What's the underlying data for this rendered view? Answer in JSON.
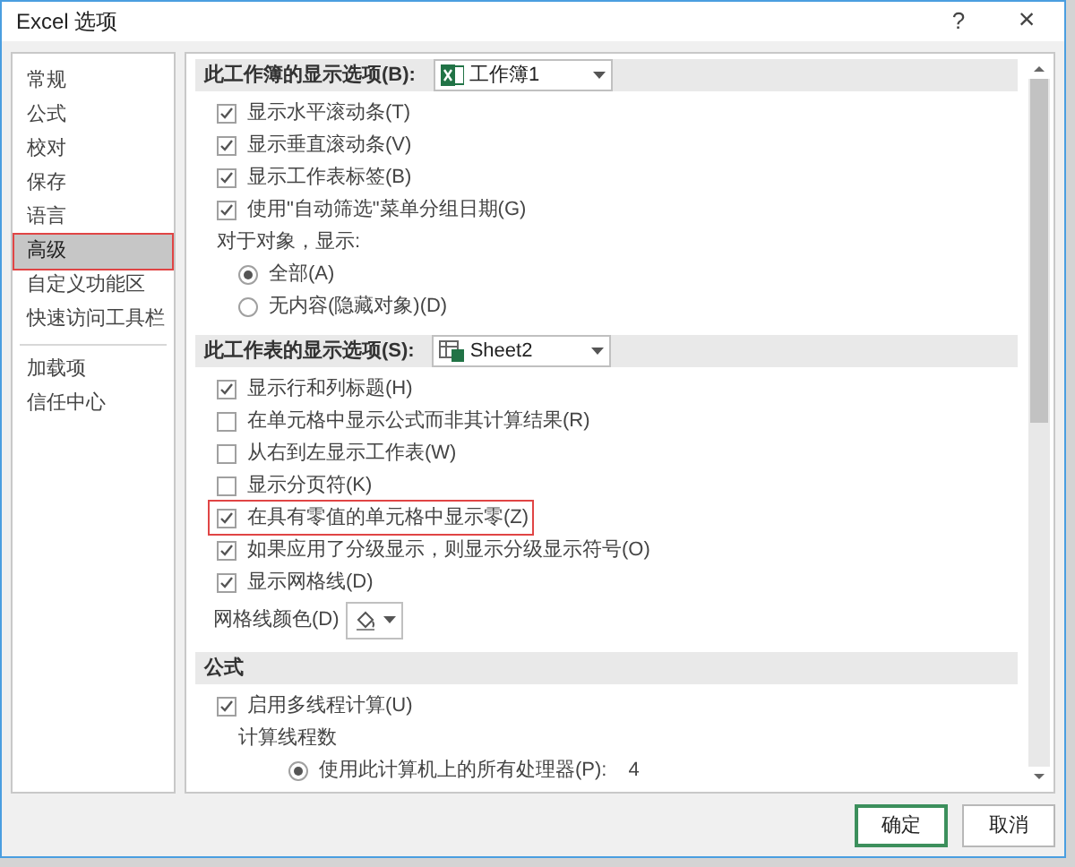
{
  "window": {
    "title": "Excel 选项",
    "help": "?",
    "close": "×"
  },
  "sidebar": {
    "items": [
      {
        "label": "常规",
        "selected": false,
        "highlighted": false
      },
      {
        "label": "公式",
        "selected": false,
        "highlighted": false
      },
      {
        "label": "校对",
        "selected": false,
        "highlighted": false
      },
      {
        "label": "保存",
        "selected": false,
        "highlighted": false
      },
      {
        "label": "语言",
        "selected": false,
        "highlighted": false
      },
      {
        "label": "高级",
        "selected": true,
        "highlighted": true
      },
      {
        "label": "自定义功能区",
        "selected": false,
        "highlighted": false
      },
      {
        "label": "快速访问工具栏",
        "selected": false,
        "highlighted": false,
        "divider_after": true
      },
      {
        "label": "加载项",
        "selected": false,
        "highlighted": false
      },
      {
        "label": "信任中心",
        "selected": false,
        "highlighted": false
      }
    ]
  },
  "sections": [
    {
      "title": "此工作簿的显示选项(B):",
      "dropdown": {
        "kind": "workbook",
        "value": "工作簿1"
      },
      "items": [
        {
          "kind": "checkbox",
          "label": "显示水平滚动条(T)",
          "checked": true,
          "highlighted": false
        },
        {
          "kind": "checkbox",
          "label": "显示垂直滚动条(V)",
          "checked": true,
          "highlighted": false
        },
        {
          "kind": "checkbox",
          "label": "显示工作表标签(B)",
          "checked": true,
          "highlighted": false
        },
        {
          "kind": "checkbox",
          "label": "使用\"自动筛选\"菜单分组日期(G)",
          "checked": true,
          "highlighted": false
        },
        {
          "kind": "label",
          "label": "对于对象，显示:"
        },
        {
          "kind": "radio",
          "label": "全部(A)",
          "selected": true
        },
        {
          "kind": "radio",
          "label": "无内容(隐藏对象)(D)",
          "selected": false
        }
      ]
    },
    {
      "title": "此工作表的显示选项(S):",
      "dropdown": {
        "kind": "sheet",
        "value": "Sheet2"
      },
      "items": [
        {
          "kind": "checkbox",
          "label": "显示行和列标题(H)",
          "checked": true,
          "highlighted": false
        },
        {
          "kind": "checkbox",
          "label": "在单元格中显示公式而非其计算结果(R)",
          "checked": false,
          "highlighted": false
        },
        {
          "kind": "checkbox",
          "label": "从右到左显示工作表(W)",
          "checked": false,
          "highlighted": false
        },
        {
          "kind": "checkbox",
          "label": "显示分页符(K)",
          "checked": false,
          "highlighted": false
        },
        {
          "kind": "checkbox",
          "label": "在具有零值的单元格中显示零(Z)",
          "checked": true,
          "highlighted": true
        },
        {
          "kind": "checkbox",
          "label": "如果应用了分级显示，则显示分级显示符号(O)",
          "checked": true,
          "highlighted": false
        },
        {
          "kind": "checkbox",
          "label": "显示网格线(D)",
          "checked": true,
          "highlighted": false
        },
        {
          "kind": "color",
          "label": "网格线颜色(D)"
        }
      ]
    },
    {
      "title": "公式",
      "items": [
        {
          "kind": "checkbox",
          "label": "启用多线程计算(U)",
          "checked": true,
          "highlighted": false
        },
        {
          "kind": "label",
          "label": "计算线程数"
        },
        {
          "kind": "radio",
          "label": "使用此计算机上的所有处理器(P):",
          "value": "4",
          "selected": true
        }
      ]
    }
  ],
  "buttons": [
    {
      "label": "确定",
      "default": true
    },
    {
      "label": "取消",
      "default": false
    }
  ]
}
